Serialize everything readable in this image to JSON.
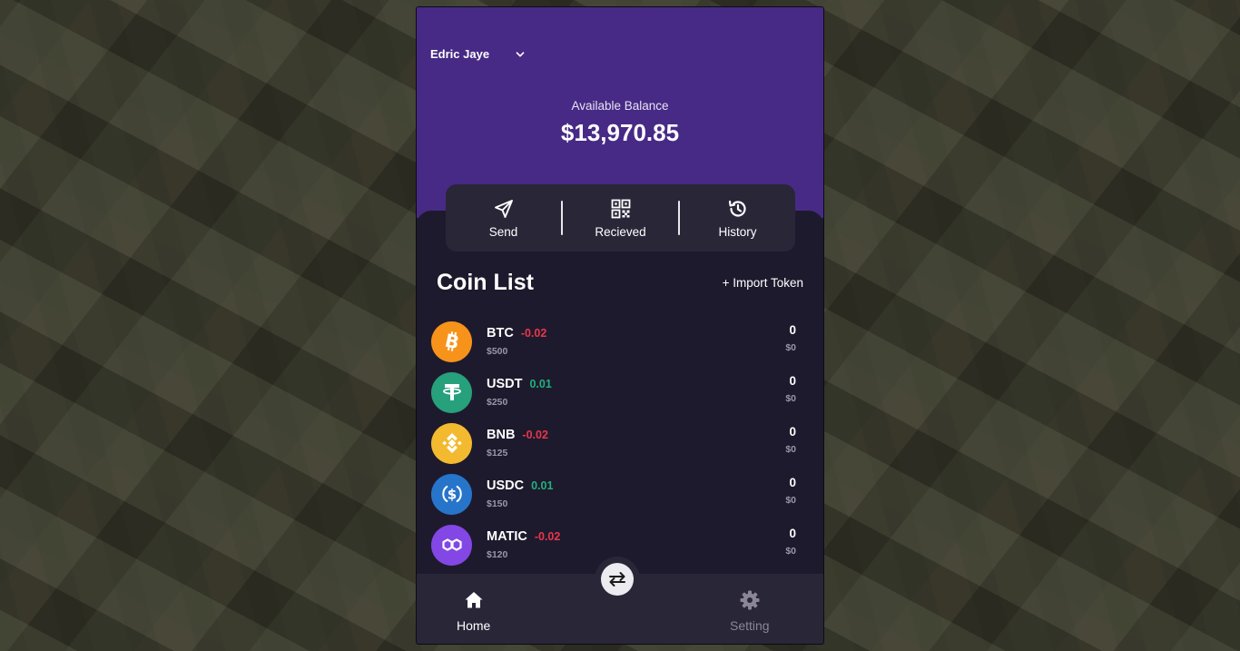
{
  "user": {
    "name": "Edric Jaye",
    "dropdown_icon": "chevron-down-icon"
  },
  "balance": {
    "label": "Available Balance",
    "value": "$13,970.85"
  },
  "actions": [
    {
      "label": "Send",
      "icon": "send-icon"
    },
    {
      "label": "Recieved",
      "icon": "qr-code-icon"
    },
    {
      "label": "History",
      "icon": "history-icon"
    }
  ],
  "coin_list": {
    "title": "Coin List",
    "import_label": "+ Import Token",
    "coins": [
      {
        "symbol": "BTC",
        "change": "-0.02",
        "usd": "$500",
        "amount": "0",
        "value": "$0",
        "color": "#f7931a",
        "trend": "negative"
      },
      {
        "symbol": "USDT",
        "change": "0.01",
        "usd": "$250",
        "amount": "0",
        "value": "$0",
        "color": "#26a17b",
        "trend": "positive"
      },
      {
        "symbol": "BNB",
        "change": "-0.02",
        "usd": "$125",
        "amount": "0",
        "value": "$0",
        "color": "#f3ba2f",
        "trend": "negative"
      },
      {
        "symbol": "USDC",
        "change": "0.01",
        "usd": "$150",
        "amount": "0",
        "value": "$0",
        "color": "#2775ca",
        "trend": "positive"
      },
      {
        "symbol": "MATIC",
        "change": "-0.02",
        "usd": "$120",
        "amount": "0",
        "value": "$0",
        "color": "#8247e5",
        "trend": "negative"
      }
    ]
  },
  "tabbar": {
    "home_label": "Home",
    "setting_label": "Setting",
    "swap_icon": "swap-arrows-icon"
  },
  "colors": {
    "header_purple": "#472a85",
    "panel_dark": "#1e1a2d",
    "card_dark": "#292638",
    "negative": "#e8364a",
    "positive": "#21b07f"
  }
}
